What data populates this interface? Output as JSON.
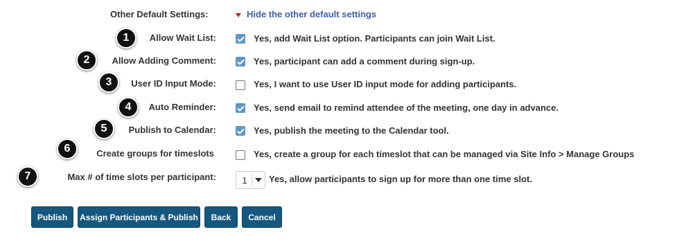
{
  "header": {
    "label": "Other Default Settings:",
    "toggle_link": "Hide the other default settings"
  },
  "settings": [
    {
      "badge": "1",
      "label": "Allow Wait List:",
      "checked": true,
      "text": "Yes, add Wait List option. Participants can join Wait List."
    },
    {
      "badge": "2",
      "label": "Allow Adding Comment:",
      "checked": true,
      "text": "Yes, participant can add a comment during sign-up."
    },
    {
      "badge": "3",
      "label": "User ID Input Mode:",
      "checked": false,
      "text": "Yes, I want to use User ID input mode for adding participants."
    },
    {
      "badge": "4",
      "label": "Auto Reminder:",
      "checked": true,
      "text": "Yes, send email to remind attendee of the meeting, one day in advance."
    },
    {
      "badge": "5",
      "label": "Publish to Calendar:",
      "checked": true,
      "text": "Yes, publish the meeting to the Calendar tool."
    },
    {
      "badge": "6",
      "label": "Create groups for timeslots",
      "checked": false,
      "text": "Yes, create a group for each timeslot that can be managed via Site Info > Manage Groups"
    },
    {
      "badge": "7",
      "label": "Max # of time slots per participant:",
      "select_value": "1",
      "text": "Yes, allow participants to sign up for more than one time slot."
    }
  ],
  "buttons": {
    "publish": "Publish",
    "assign_publish": "Assign Participants & Publish",
    "back": "Back",
    "cancel": "Cancel"
  },
  "colors": {
    "button_bg": "#15577f",
    "checkbox_checked": "#5f97c6",
    "link": "#3a60a9",
    "caret": "#b3261e",
    "badge": "#111111"
  },
  "icons": {
    "toggle": "caret-down-icon",
    "checkbox": "checkmark-icon",
    "select": "chevron-down-icon"
  }
}
